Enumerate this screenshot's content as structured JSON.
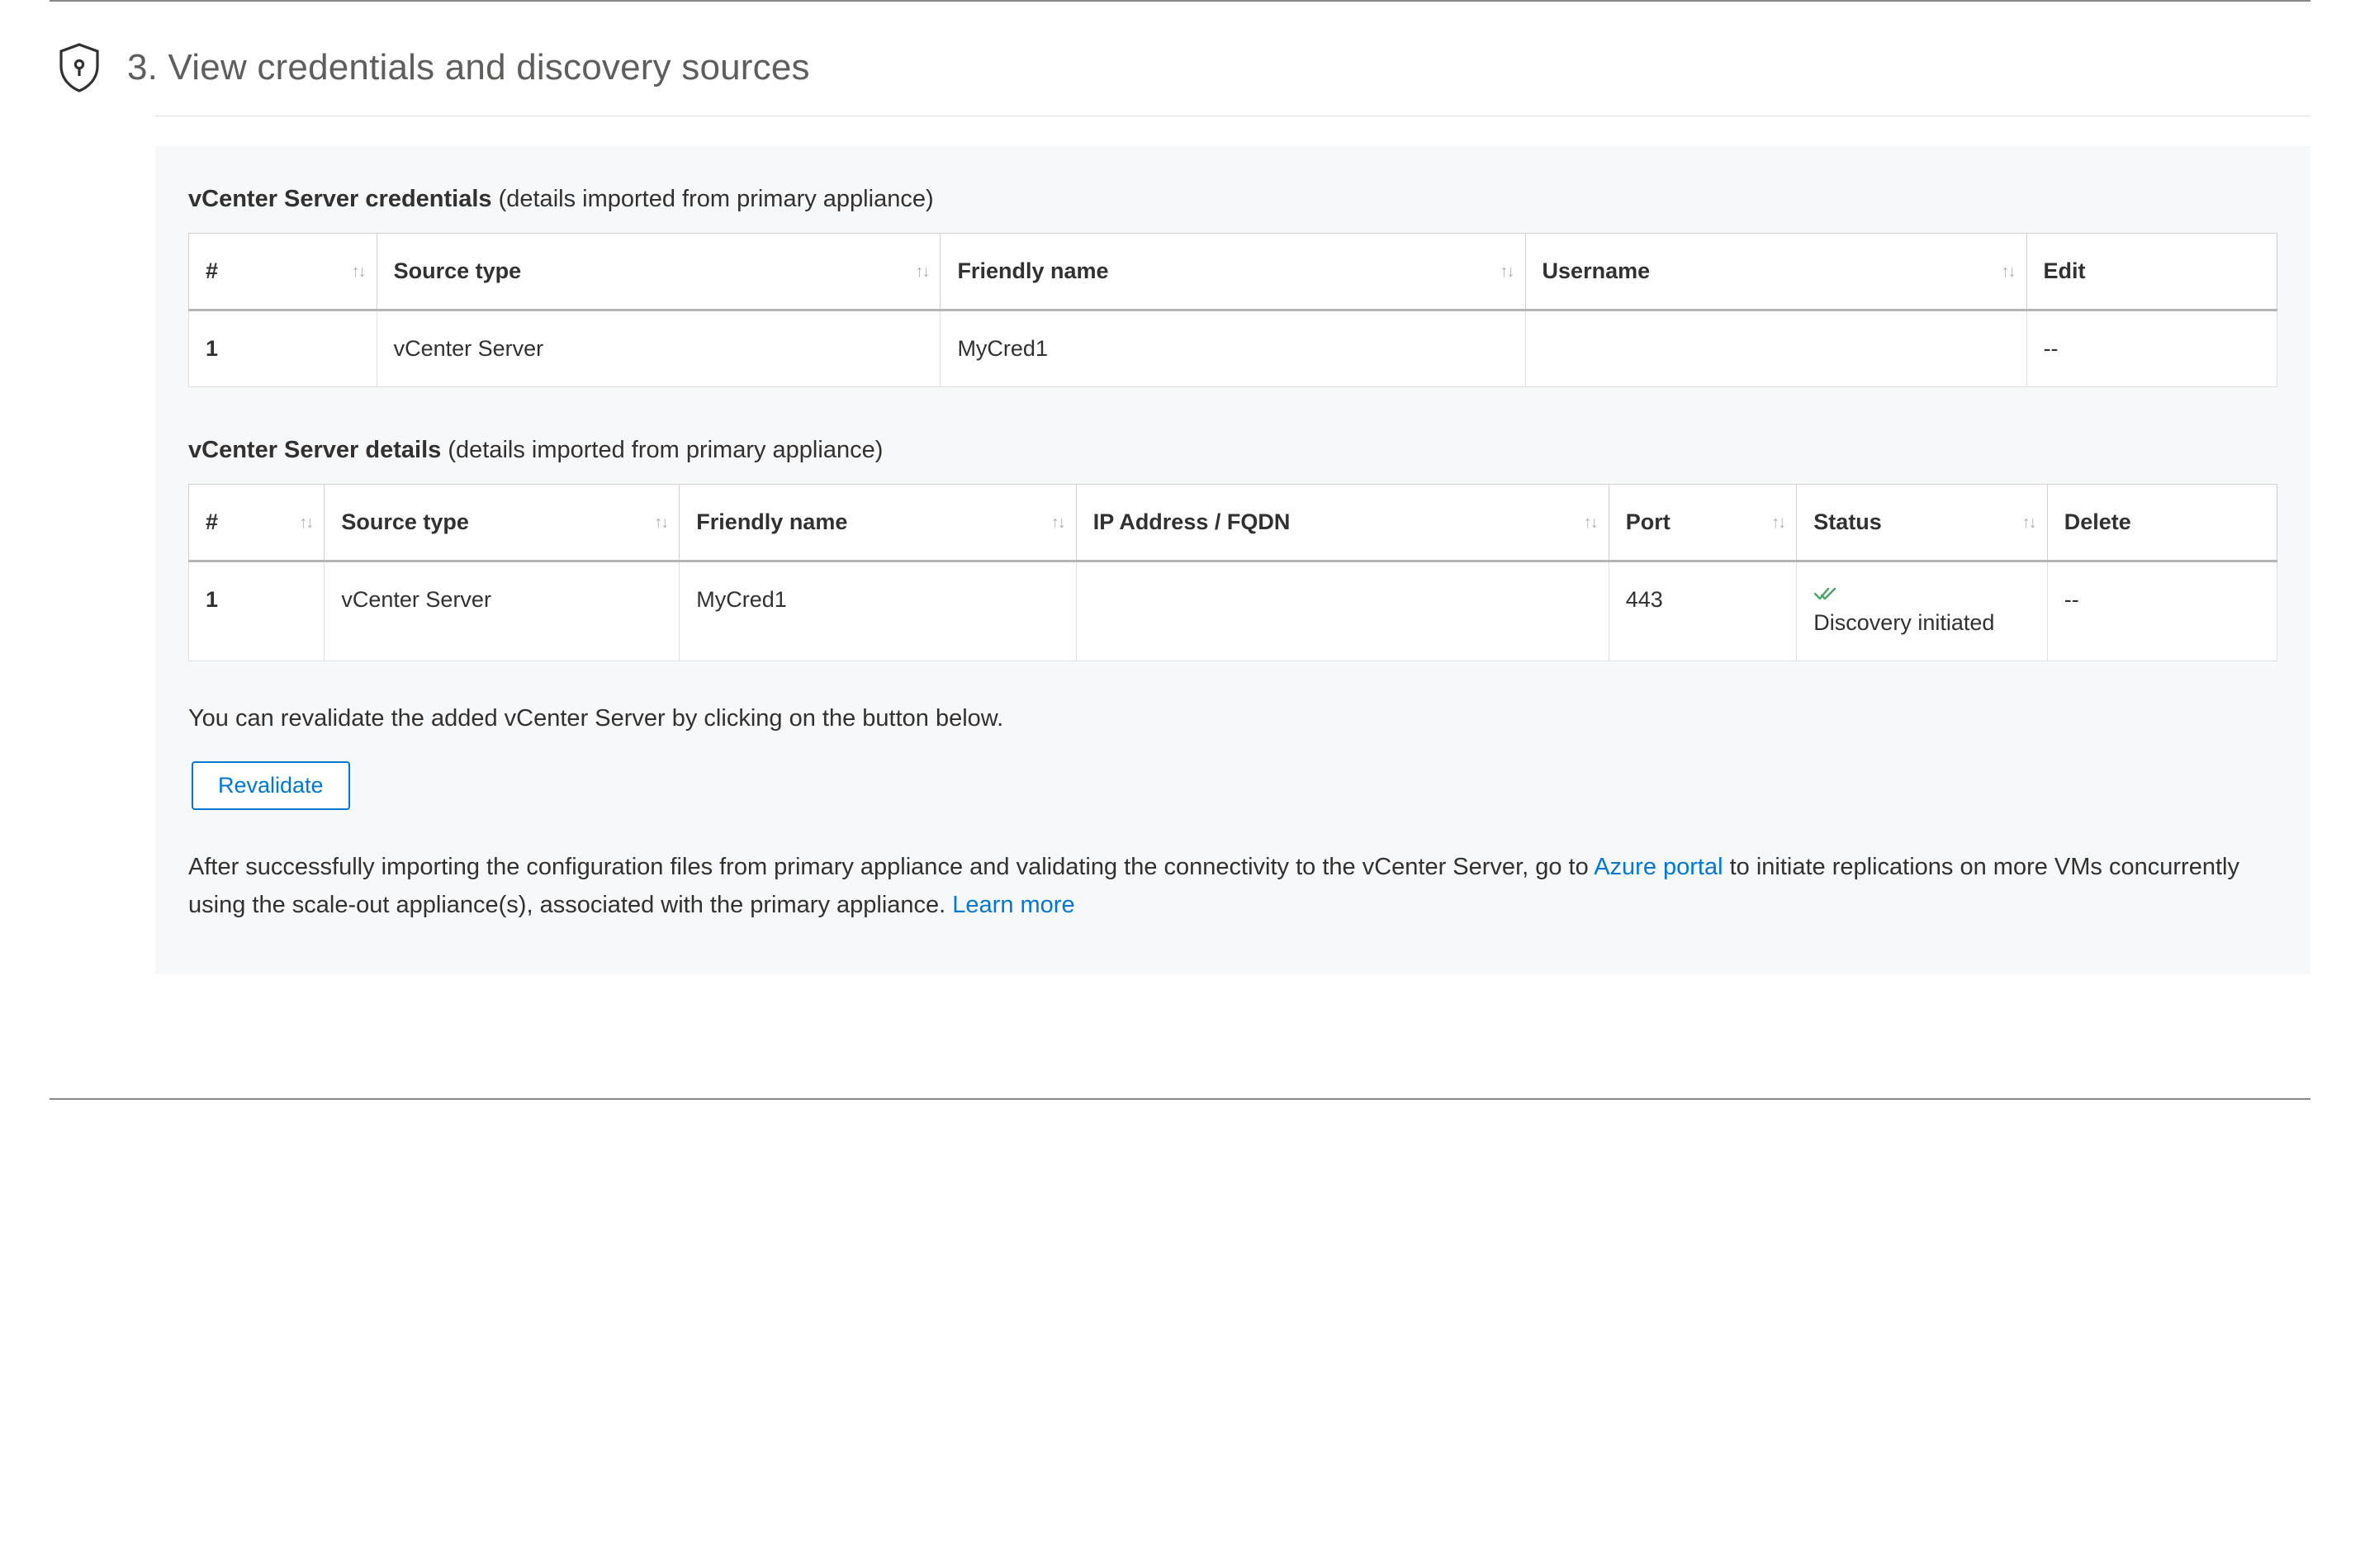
{
  "step": {
    "number": "3.",
    "title": "View credentials and discovery sources"
  },
  "credentials_section": {
    "label_bold": "vCenter Server credentials",
    "label_light": " (details imported from primary appliance)",
    "columns": {
      "num": "#",
      "source_type": "Source type",
      "friendly_name": "Friendly name",
      "username": "Username",
      "edit": "Edit"
    },
    "rows": [
      {
        "num": "1",
        "source_type": "vCenter Server",
        "friendly_name": "MyCred1",
        "username": "",
        "edit": "--"
      }
    ]
  },
  "details_section": {
    "label_bold": "vCenter Server details",
    "label_light": " (details imported from primary appliance)",
    "columns": {
      "num": "#",
      "source_type": "Source type",
      "friendly_name": "Friendly name",
      "ip": "IP Address / FQDN",
      "port": "Port",
      "status": "Status",
      "delete": "Delete"
    },
    "rows": [
      {
        "num": "1",
        "source_type": "vCenter Server",
        "friendly_name": "MyCred1",
        "ip": "",
        "port": "443",
        "status_text": "Discovery initiated",
        "delete": "--"
      }
    ]
  },
  "revalidate": {
    "help": "You can revalidate the added vCenter Server by clicking on the button below.",
    "button": "Revalidate"
  },
  "footer": {
    "part1": "After successfully importing the configuration files from primary appliance and validating the connectivity to the vCenter Server, go to ",
    "link1": "Azure portal",
    "part2": " to initiate replications on more VMs concurrently using the scale-out appliance(s), associated with the primary appliance. ",
    "link2": "Learn more"
  }
}
